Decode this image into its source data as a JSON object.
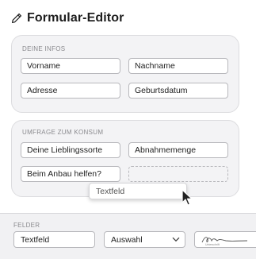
{
  "header": {
    "title": "Formular-Editor",
    "icon": "pencil-icon"
  },
  "info_section": {
    "label": "DEINE INFOS",
    "fields": [
      "Vorname",
      "Nachname",
      "Adresse",
      "Geburtsdatum"
    ]
  },
  "survey_section": {
    "label": "UMFRAGE ZUM KONSUM",
    "fields": [
      "Deine Lieblingssorte",
      "Abnahmemenge",
      "Beim Anbau helfen?"
    ],
    "drop_target": ""
  },
  "drag": {
    "ghost_label": "Textfeld",
    "cursor_icon": "cursor-arrow-icon"
  },
  "palette": {
    "label": "FELDER",
    "textfield_label": "Textfeld",
    "select_label": "Auswahl",
    "select_icon": "chevron-down-icon",
    "signature_icon": "signature-icon",
    "signature_caption": "Unterschrift"
  }
}
